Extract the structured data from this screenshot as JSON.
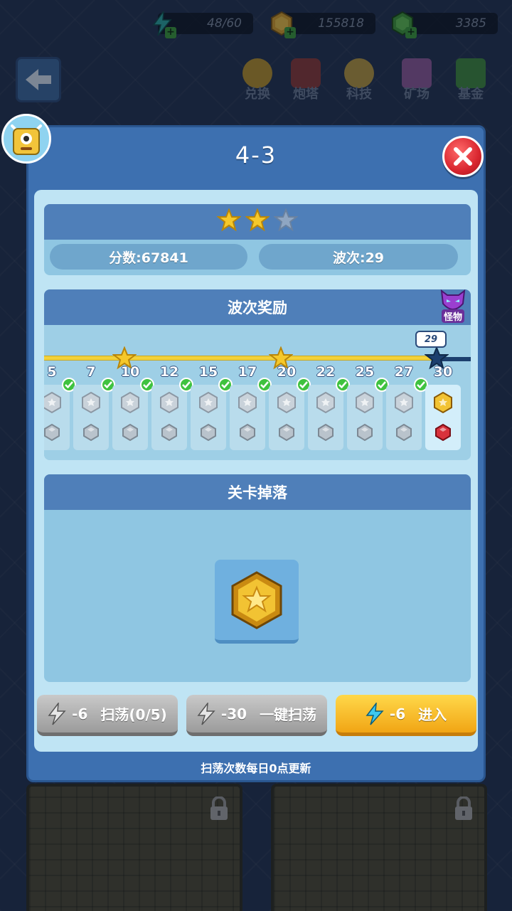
{
  "resources": {
    "energy": "48/60",
    "coins": "155818",
    "gems": "3385"
  },
  "topnav": [
    {
      "label": "兑换",
      "icon": "exchange-icon",
      "color": "#c4a33a"
    },
    {
      "label": "炮塔",
      "icon": "turret-icon",
      "color": "#b84a4a"
    },
    {
      "label": "科技",
      "icon": "tech-icon",
      "color": "#c7a64a"
    },
    {
      "label": "矿场",
      "icon": "mine-icon",
      "color": "#a96ab8"
    },
    {
      "label": "基金",
      "icon": "fund-icon",
      "color": "#4fa84f"
    }
  ],
  "dialog": {
    "title": "4-3",
    "stars_earned": 2,
    "stars_total": 3,
    "score_label": "分数:67841",
    "wave_label": "波次:29"
  },
  "wave_reward": {
    "title": "波次奖励",
    "monster_label": "怪物",
    "current_wave": "29",
    "waves": [
      {
        "num": "5",
        "claimed": true
      },
      {
        "num": "7",
        "claimed": true
      },
      {
        "num": "10",
        "claimed": true
      },
      {
        "num": "12",
        "claimed": true
      },
      {
        "num": "15",
        "claimed": true
      },
      {
        "num": "17",
        "claimed": true
      },
      {
        "num": "20",
        "claimed": true
      },
      {
        "num": "22",
        "claimed": true
      },
      {
        "num": "25",
        "claimed": true
      },
      {
        "num": "27",
        "claimed": true
      },
      {
        "num": "30",
        "claimed": false
      }
    ]
  },
  "drops": {
    "title": "关卡掉落",
    "items": [
      "gold-coin-icon"
    ]
  },
  "buttons": {
    "sweep_cost": "-6",
    "sweep_label": "扫荡(0/5)",
    "sweep_all_cost": "-30",
    "sweep_all_label": "一键扫荡",
    "enter_cost": "-6",
    "enter_label": "进入"
  },
  "hint": "扫荡次数每日0点更新",
  "colors": {
    "dialog_blue": "#3d70b0",
    "header_blue": "#4f7fb9",
    "gold_button": "#f1a514",
    "close_red": "#d9262f"
  }
}
